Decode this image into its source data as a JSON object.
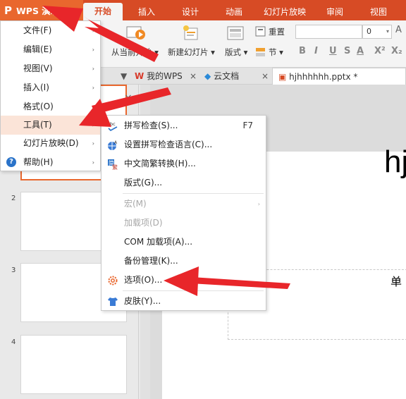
{
  "app": {
    "logo_glyph": "P",
    "name": "WPS 演示",
    "arrow": "▾"
  },
  "tabs": [
    "开始",
    "插入",
    "设计",
    "动画",
    "幻灯片放映",
    "审阅",
    "视图"
  ],
  "ribbon": {
    "from_current": "从当前开始",
    "new_slide": "新建幻灯片",
    "layout": "版式",
    "reset": "重置",
    "section": "节",
    "font_size": "0",
    "format_buttons": [
      "B",
      "I",
      "U",
      "S",
      "A",
      "X²",
      "X₂"
    ]
  },
  "doc_tabs": {
    "my_wps": "我的WPS",
    "cloud": "云文档",
    "file": "hjhhhhhh.pptx *",
    "close_glyph": "×"
  },
  "main_menu": [
    {
      "label": "文件(F)",
      "has_sub": true
    },
    {
      "label": "编辑(E)",
      "has_sub": true
    },
    {
      "label": "视图(V)",
      "has_sub": true
    },
    {
      "label": "插入(I)",
      "has_sub": true
    },
    {
      "label": "格式(O)",
      "has_sub": true
    },
    {
      "label": "工具(T)",
      "has_sub": true
    },
    {
      "label": "幻灯片放映(D)",
      "has_sub": true
    },
    {
      "label": "帮助(H)",
      "has_sub": true
    }
  ],
  "tools_menu": {
    "spell_check": {
      "label": "拼写检查(S)...",
      "shortcut": "F7"
    },
    "spell_lang": "设置拼写检查语言(C)...",
    "chinese_convert": "中文简繁转换(H)...",
    "layout": "版式(G)...",
    "macro": "宏(M)",
    "addins": "加载项(D)",
    "com_addins": "COM 加载项(A)...",
    "backup": "备份管理(K)...",
    "options": "选项(O)...",
    "skin": "皮肤(Y)..."
  },
  "slides": {
    "numbers": [
      "2",
      "3",
      "4"
    ],
    "title_text": "hj",
    "subtitle_text": "单"
  },
  "icons": {
    "submenu_arrow": "›",
    "help": "?"
  },
  "colors": {
    "menubar": "#d74b25",
    "accent": "#e9672e",
    "highlight": "#fbe4d8",
    "arrow_red": "#e8262a"
  }
}
